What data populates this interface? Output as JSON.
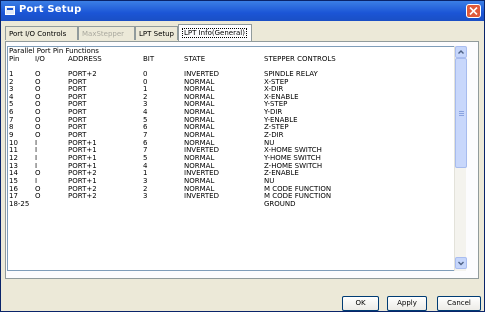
{
  "window": {
    "title": "Port Setup"
  },
  "tabs": [
    {
      "label": "Port I/O Controls",
      "state": "normal"
    },
    {
      "label": "MaxStepper",
      "state": "disabled"
    },
    {
      "label": "LPT Setup",
      "state": "normal"
    },
    {
      "label": "LPT Info(General)",
      "state": "active"
    }
  ],
  "list": {
    "heading": "Parallel Port Pin Functions",
    "columns": [
      "Pin",
      "I/O",
      "ADDRESS",
      "BIT",
      "STATE",
      "STEPPER CONTROLS"
    ],
    "rows": [
      [
        "1",
        "O",
        "PORT+2",
        "0",
        "INVERTED",
        "SPINDLE RELAY"
      ],
      [
        "2",
        "O",
        "PORT",
        "0",
        "NORMAL",
        "X-STEP"
      ],
      [
        "3",
        "O",
        "PORT",
        "1",
        "NORMAL",
        "X-DIR"
      ],
      [
        "4",
        "O",
        "PORT",
        "2",
        "NORMAL",
        "X-ENABLE"
      ],
      [
        "5",
        "O",
        "PORT",
        "3",
        "NORMAL",
        "Y-STEP"
      ],
      [
        "6",
        "O",
        "PORT",
        "4",
        "NORMAL",
        "Y-DIR"
      ],
      [
        "7",
        "O",
        "PORT",
        "5",
        "NORMAL",
        "Y-ENABLE"
      ],
      [
        "8",
        "O",
        "PORT",
        "6",
        "NORMAL",
        "Z-STEP"
      ],
      [
        "9",
        "O",
        "PORT",
        "7",
        "NORMAL",
        "Z-DIR"
      ],
      [
        "10",
        "I",
        "PORT+1",
        "6",
        "NORMAL",
        "NU"
      ],
      [
        "11",
        "I",
        "PORT+1",
        "7",
        "INVERTED",
        "X-HOME SWITCH"
      ],
      [
        "12",
        "I",
        "PORT+1",
        "5",
        "NORMAL",
        "Y-HOME SWITCH"
      ],
      [
        "13",
        "I",
        "PORT+1",
        "4",
        "NORMAL",
        "Z-HOME SWITCH"
      ],
      [
        "14",
        "O",
        "PORT+2",
        "1",
        "INVERTED",
        "Z-ENABLE"
      ],
      [
        "15",
        "I",
        "PORT+1",
        "3",
        "NORMAL",
        "NU"
      ],
      [
        "16",
        "O",
        "PORT+2",
        "2",
        "NORMAL",
        "M CODE FUNCTION"
      ],
      [
        "17",
        "O",
        "PORT+2",
        "3",
        "INVERTED",
        "M CODE FUNCTION"
      ],
      [
        "18-25",
        "",
        "",
        "",
        "",
        "GROUND"
      ]
    ]
  },
  "buttons": {
    "ok": "OK",
    "apply": "Apply",
    "cancel": "Cancel"
  }
}
